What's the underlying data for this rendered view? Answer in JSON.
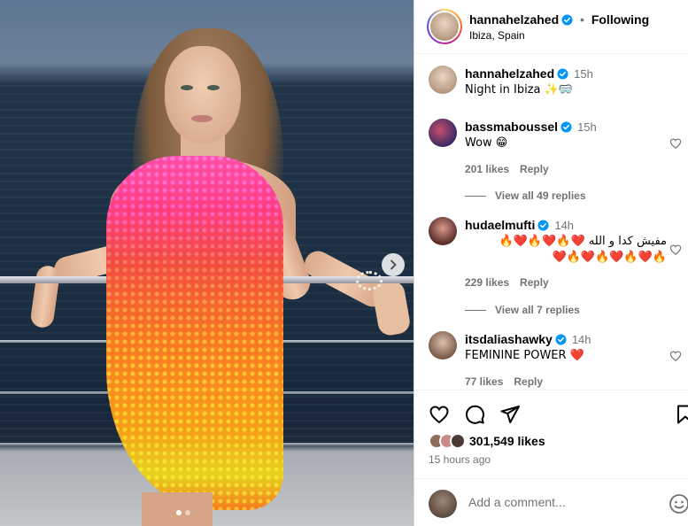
{
  "post": {
    "carousel": {
      "slide_count": 2,
      "current_slide": 1
    },
    "author": {
      "username": "hannahelzahed",
      "verified": true,
      "separator": "•",
      "follow_status": "Following",
      "location": "Ibiza, Spain"
    },
    "caption": {
      "username": "hannahelzahed",
      "time": "15h",
      "text": "Night in Ibiza ✨🥽"
    },
    "comments": [
      {
        "username": "bassmaboussel",
        "time": "15h",
        "text": "Wow 😁",
        "likes": "201 likes",
        "reply_label": "Reply",
        "view_replies": "View all 49 replies"
      },
      {
        "username": "hudaelmufti",
        "time": "14h",
        "text": "مفيش كدا و الله ❤️🔥❤️🔥❤️🔥",
        "text_line2": "🔥❤️🔥❤️🔥❤️🔥❤️",
        "likes": "229 likes",
        "reply_label": "Reply",
        "view_replies": "View all 7 replies"
      },
      {
        "username": "itsdaliashawky",
        "time": "14h",
        "text": "FEMININE POWER ❤️",
        "likes": "77 likes",
        "reply_label": "Reply"
      }
    ],
    "likes": "301,549 likes",
    "posted_ago": "15 hours ago",
    "add_comment_placeholder": "Add a comment..."
  },
  "icons": {
    "verified": "verified-badge-icon",
    "next": "chevron-right-icon",
    "like": "heart-icon",
    "comment": "comment-bubble-icon",
    "share": "paper-plane-icon",
    "save": "bookmark-icon",
    "emoji": "smiley-icon"
  },
  "colors": {
    "verified_blue": "#0095f6",
    "secondary_text": "#737373",
    "border": "#dbdbdb"
  }
}
